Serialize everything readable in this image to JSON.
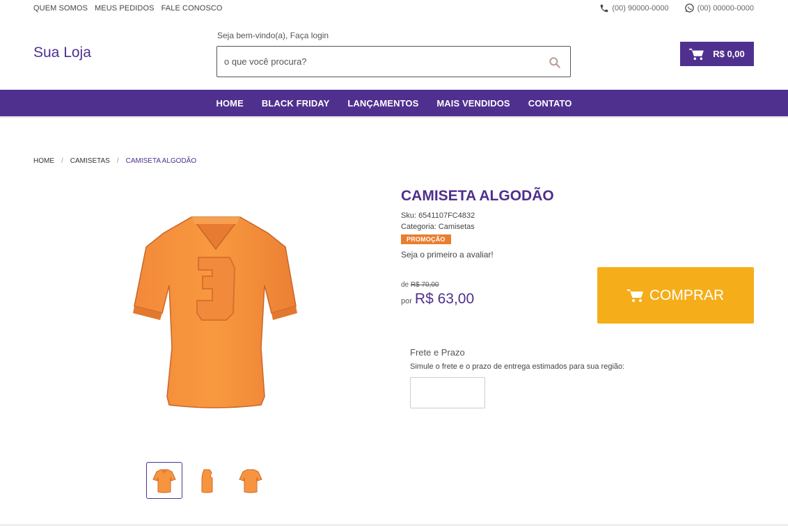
{
  "top_links": [
    "QUEM SOMOS",
    "MEUS PEDIDOS",
    "FALE CONOSCO"
  ],
  "contacts": {
    "phone_icon": "phone-icon",
    "phone": "(00) 90000-0000",
    "whatsapp_icon": "whatsapp-icon",
    "whatsapp": "(00) 00000-0000"
  },
  "header": {
    "logo": "Sua Loja",
    "welcome": "Seja bem-vindo(a), Faça login",
    "search_placeholder": "o que você procura?",
    "search_icon": "search-icon",
    "cart_icon": "cart-icon",
    "cart_total": "R$ 0,00"
  },
  "nav": [
    "HOME",
    "BLACK FRIDAY",
    "LANÇAMENTOS",
    "MAIS VENDIDOS",
    "CONTATO"
  ],
  "breadcrumb": {
    "items": [
      "HOME",
      "CAMISETAS",
      "CAMISETA ALGODÃO"
    ],
    "separator": "/"
  },
  "product": {
    "title": "CAMISETA ALGODÃO",
    "sku": "Sku: 6541107FC4832",
    "category": "Categoria: Camisetas",
    "badge": "PROMOÇÃO",
    "rating_text": "Seja o primeiro a avaliar!",
    "old_price_prefix": "de",
    "old_price": "R$ 70,00",
    "new_price_prefix": "por",
    "new_price": "R$ 63,00",
    "buy_label": "COMPRAR",
    "buy_icon": "cart-icon"
  },
  "shipping": {
    "title": "Frete e Prazo",
    "description": "Simule o frete e o prazo de entrega estimados para sua região:",
    "cep_value": ""
  },
  "colors": {
    "brand": "#50308f",
    "buy_button": "#f5ae19",
    "badge": "#e97e2f",
    "shirt": "#f7943f"
  }
}
